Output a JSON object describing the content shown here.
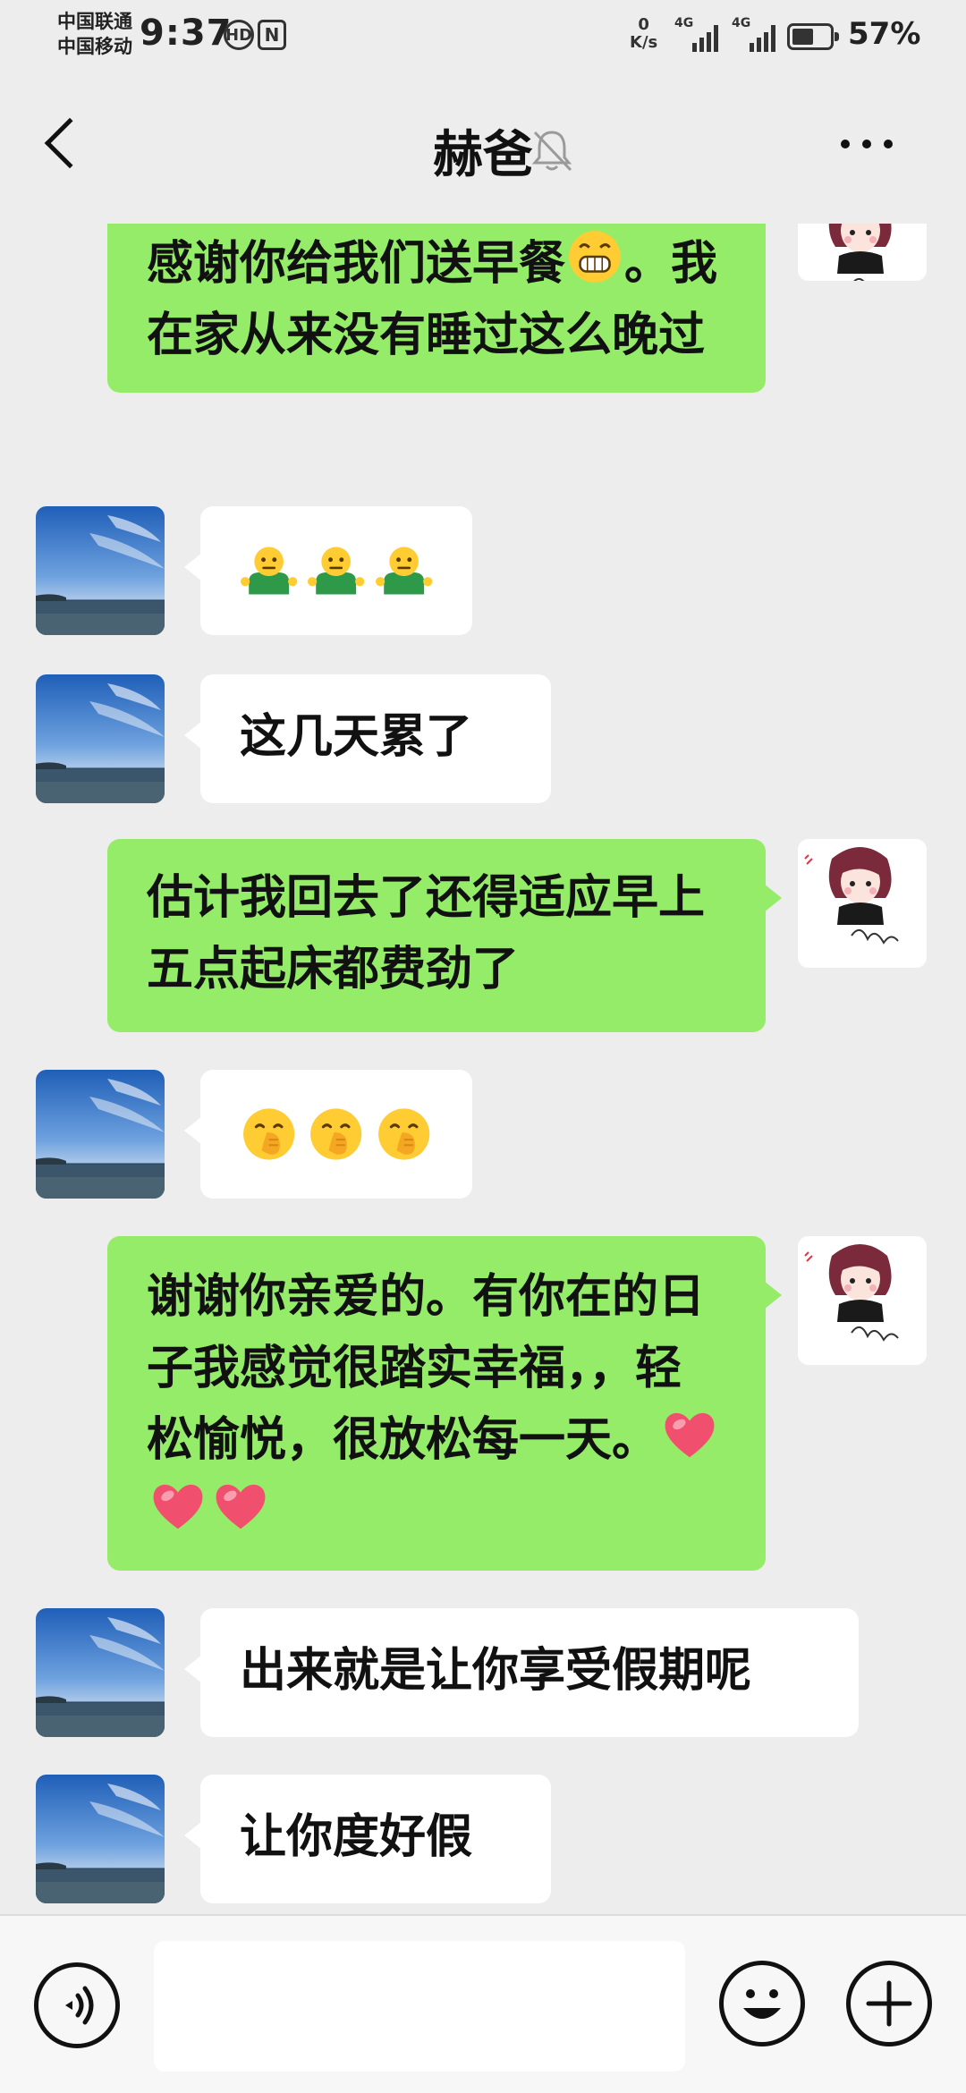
{
  "status_bar": {
    "carrier_1": "中国联通",
    "carrier_2": "中国移动",
    "time": "9:37",
    "net_speed_value": "0",
    "net_speed_unit": "K/s",
    "signal_1_label": "4G",
    "signal_2_label": "4G",
    "battery_percent": "57%",
    "battery_level": 0.57
  },
  "header": {
    "title": "赫爸",
    "back_icon": "chevron-left-icon",
    "mute_icon": "bell-muted-icon",
    "more_icon": "more-dots-icon"
  },
  "messages": [
    {
      "side": "right",
      "text_before_emoji": "感谢你给我们送早餐",
      "emoji": "grin-emoji",
      "text_after_emoji": "。我在家从来没有睡过这么晚过"
    },
    {
      "side": "left",
      "emojis": [
        "shrug-emoji",
        "shrug-emoji",
        "shrug-emoji"
      ]
    },
    {
      "side": "left",
      "text": "这几天累了"
    },
    {
      "side": "right",
      "text": "估计我回去了还得适应早上五点起床都费劲了"
    },
    {
      "side": "left",
      "emojis": [
        "chuckle-emoji",
        "chuckle-emoji",
        "chuckle-emoji"
      ]
    },
    {
      "side": "right",
      "text": "谢谢你亲爱的。有你在的日子我感觉很踏实幸福，，轻松愉悦，很放松每一天。",
      "emojis": [
        "heart-emoji",
        "heart-emoji",
        "heart-emoji"
      ]
    },
    {
      "side": "left",
      "text": "出来就是让你享受假期呢"
    },
    {
      "side": "left",
      "text": "让你度好假"
    }
  ],
  "input_bar": {
    "voice_icon": "voice-icon",
    "emoji_icon": "smiley-icon",
    "plus_icon": "plus-icon",
    "text_value": ""
  },
  "colors": {
    "background": "#ededed",
    "my_bubble": "#95ec69",
    "their_bubble": "#ffffff"
  }
}
